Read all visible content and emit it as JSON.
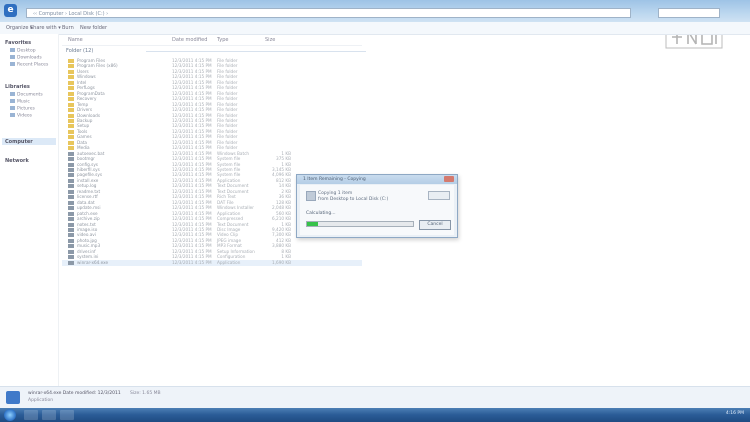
{
  "window": {
    "address_path": "‹‹ Computer › Local Disk (C:) ›",
    "app_icon_label": "e"
  },
  "toolbar": {
    "items": [
      "Organize ▾",
      "Share with ▾",
      "Burn",
      "New folder"
    ]
  },
  "nav": {
    "favorites_header": "Favorites",
    "favorites": [
      "Desktop",
      "Downloads",
      "Recent Places"
    ],
    "libraries_header": "Libraries",
    "libraries": [
      "Documents",
      "Music",
      "Pictures",
      "Videos"
    ],
    "computer_header": "Computer",
    "network_header": "Network"
  },
  "columns": {
    "name": "Name",
    "date": "Date modified",
    "type": "Type",
    "size": "Size"
  },
  "group": {
    "label": "Folder (12)"
  },
  "files": [
    {
      "name": "Program Files",
      "date": "12/3/2011 4:15 PM",
      "type": "File folder",
      "size": "",
      "kind": "folder"
    },
    {
      "name": "Program Files (x86)",
      "date": "12/3/2011 4:15 PM",
      "type": "File folder",
      "size": "",
      "kind": "folder"
    },
    {
      "name": "Users",
      "date": "12/3/2011 4:15 PM",
      "type": "File folder",
      "size": "",
      "kind": "folder"
    },
    {
      "name": "Windows",
      "date": "12/3/2011 4:15 PM",
      "type": "File folder",
      "size": "",
      "kind": "folder"
    },
    {
      "name": "Intel",
      "date": "12/3/2011 4:15 PM",
      "type": "File folder",
      "size": "",
      "kind": "folder"
    },
    {
      "name": "PerfLogs",
      "date": "12/3/2011 4:15 PM",
      "type": "File folder",
      "size": "",
      "kind": "folder"
    },
    {
      "name": "ProgramData",
      "date": "12/3/2011 4:15 PM",
      "type": "File folder",
      "size": "",
      "kind": "folder"
    },
    {
      "name": "Recovery",
      "date": "12/3/2011 4:15 PM",
      "type": "File folder",
      "size": "",
      "kind": "folder"
    },
    {
      "name": "Temp",
      "date": "12/3/2011 4:15 PM",
      "type": "File folder",
      "size": "",
      "kind": "folder"
    },
    {
      "name": "Drivers",
      "date": "12/3/2011 4:15 PM",
      "type": "File folder",
      "size": "",
      "kind": "folder"
    },
    {
      "name": "Downloads",
      "date": "12/3/2011 4:15 PM",
      "type": "File folder",
      "size": "",
      "kind": "folder"
    },
    {
      "name": "Backup",
      "date": "12/3/2011 4:15 PM",
      "type": "File folder",
      "size": "",
      "kind": "folder"
    },
    {
      "name": "Setup",
      "date": "12/3/2011 4:15 PM",
      "type": "File folder",
      "size": "",
      "kind": "folder"
    },
    {
      "name": "Tools",
      "date": "12/3/2011 4:15 PM",
      "type": "File folder",
      "size": "",
      "kind": "folder"
    },
    {
      "name": "Games",
      "date": "12/3/2011 4:15 PM",
      "type": "File folder",
      "size": "",
      "kind": "folder"
    },
    {
      "name": "Data",
      "date": "12/3/2011 4:15 PM",
      "type": "File folder",
      "size": "",
      "kind": "folder"
    },
    {
      "name": "Media",
      "date": "12/3/2011 4:15 PM",
      "type": "File folder",
      "size": "",
      "kind": "folder"
    },
    {
      "name": "autoexec.bat",
      "date": "12/3/2011 4:15 PM",
      "type": "Windows Batch",
      "size": "1 KB",
      "kind": "file"
    },
    {
      "name": "bootmgr",
      "date": "12/3/2011 4:15 PM",
      "type": "System file",
      "size": "375 KB",
      "kind": "file"
    },
    {
      "name": "config.sys",
      "date": "12/3/2011 4:15 PM",
      "type": "System file",
      "size": "1 KB",
      "kind": "file"
    },
    {
      "name": "hiberfil.sys",
      "date": "12/3/2011 4:15 PM",
      "type": "System file",
      "size": "3,145 KB",
      "kind": "file"
    },
    {
      "name": "pagefile.sys",
      "date": "12/3/2011 4:15 PM",
      "type": "System file",
      "size": "4,096 KB",
      "kind": "file"
    },
    {
      "name": "install.exe",
      "date": "12/3/2011 4:15 PM",
      "type": "Application",
      "size": "812 KB",
      "kind": "file"
    },
    {
      "name": "setup.log",
      "date": "12/3/2011 4:15 PM",
      "type": "Text Document",
      "size": "14 KB",
      "kind": "file"
    },
    {
      "name": "readme.txt",
      "date": "12/3/2011 4:15 PM",
      "type": "Text Document",
      "size": "2 KB",
      "kind": "file"
    },
    {
      "name": "license.rtf",
      "date": "12/3/2011 4:15 PM",
      "type": "Rich Text",
      "size": "36 KB",
      "kind": "file"
    },
    {
      "name": "data.dat",
      "date": "12/3/2011 4:15 PM",
      "type": "DAT File",
      "size": "128 KB",
      "kind": "file"
    },
    {
      "name": "update.msi",
      "date": "12/3/2011 4:15 PM",
      "type": "Windows Installer",
      "size": "2,048 KB",
      "kind": "file"
    },
    {
      "name": "patch.exe",
      "date": "12/3/2011 4:15 PM",
      "type": "Application",
      "size": "560 KB",
      "kind": "file"
    },
    {
      "name": "archive.zip",
      "date": "12/3/2011 4:15 PM",
      "type": "Compressed",
      "size": "6,210 KB",
      "kind": "file"
    },
    {
      "name": "notes.txt",
      "date": "12/3/2011 4:15 PM",
      "type": "Text Document",
      "size": "1 KB",
      "kind": "file"
    },
    {
      "name": "image.iso",
      "date": "12/3/2011 4:15 PM",
      "type": "Disc Image",
      "size": "9,420 KB",
      "kind": "file"
    },
    {
      "name": "video.avi",
      "date": "12/3/2011 4:15 PM",
      "type": "Video Clip",
      "size": "7,300 KB",
      "kind": "file"
    },
    {
      "name": "photo.jpg",
      "date": "12/3/2011 4:15 PM",
      "type": "JPEG image",
      "size": "412 KB",
      "kind": "file"
    },
    {
      "name": "music.mp3",
      "date": "12/3/2011 4:15 PM",
      "type": "MP3 Format",
      "size": "3,880 KB",
      "kind": "file"
    },
    {
      "name": "driver.inf",
      "date": "12/3/2011 4:15 PM",
      "type": "Setup Information",
      "size": "8 KB",
      "kind": "file"
    },
    {
      "name": "system.ini",
      "date": "12/3/2011 4:15 PM",
      "type": "Configuration",
      "size": "1 KB",
      "kind": "file"
    },
    {
      "name": "winrar-x64.exe",
      "date": "12/3/2011 4:15 PM",
      "type": "Application",
      "size": "1,690 KB",
      "kind": "file"
    }
  ],
  "dialog": {
    "title": "1 Item Remaining - Copying",
    "line1": "Copying 1 item",
    "line2": "from Desktop to Local Disk (C:)",
    "label": "Calculating...",
    "button": "Cancel",
    "progress": 0.1
  },
  "details": {
    "line1": "winrar-x64.exe  Date modified: 12/3/2011",
    "line2": "Application",
    "line3": "Size: 1.65 MB"
  },
  "taskbar": {
    "clock": "4:16 PM"
  },
  "colors": {
    "progress": "#37c24a",
    "titlebar": "#bcd7ef",
    "taskbar": "#2a5b96"
  }
}
